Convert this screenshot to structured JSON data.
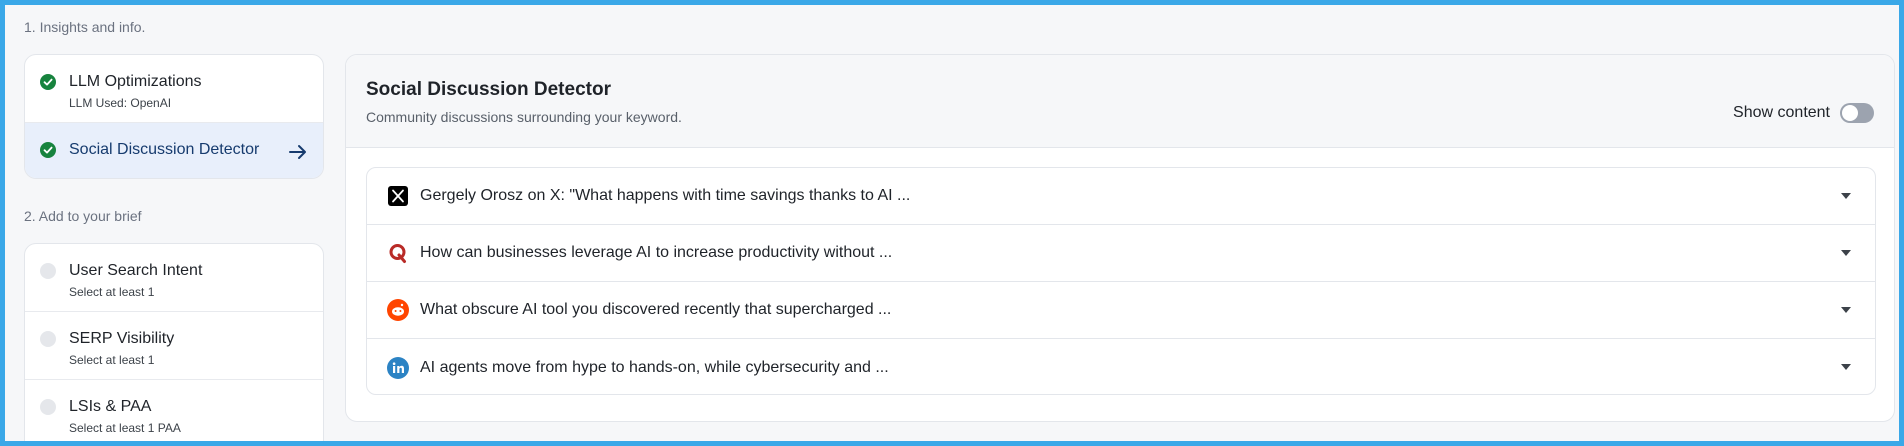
{
  "sections": {
    "insights_label": "1. Insights and info.",
    "brief_label": "2. Add to your brief"
  },
  "insights": [
    {
      "title": "LLM Optimizations",
      "subtitle": "LLM Used: OpenAI",
      "status": "done"
    },
    {
      "title": "Social Discussion Detector",
      "status": "done",
      "active": true
    }
  ],
  "brief": [
    {
      "title": "User Search Intent",
      "subtitle": "Select at least 1",
      "status": "todo"
    },
    {
      "title": "SERP Visibility",
      "subtitle": "Select at least 1",
      "status": "todo"
    },
    {
      "title": "LSIs & PAA",
      "subtitle": "Select at least 1 PAA",
      "status": "todo"
    }
  ],
  "panel": {
    "title": "Social Discussion Detector",
    "subtitle": "Community discussions surrounding your keyword.",
    "toggle_label": "Show content",
    "toggle_on": false
  },
  "discussions": [
    {
      "source": "x-icon",
      "text": "Gergely Orosz on X: \"What happens with time savings thanks to AI ..."
    },
    {
      "source": "quora-icon",
      "text": "How can businesses leverage AI to increase productivity without ..."
    },
    {
      "source": "reddit-icon",
      "text": "What obscure AI tool you discovered recently that supercharged ..."
    },
    {
      "source": "linkedin-icon",
      "text": "AI agents move from hype to hands-on, while cybersecurity and ..."
    }
  ],
  "colors": {
    "frame_border": "#3aa8e8",
    "done": "#17833e",
    "active_bg": "#e8effb",
    "reddit": "#ff4500",
    "quora": "#b92b27",
    "linkedin": "#0a66c2"
  }
}
